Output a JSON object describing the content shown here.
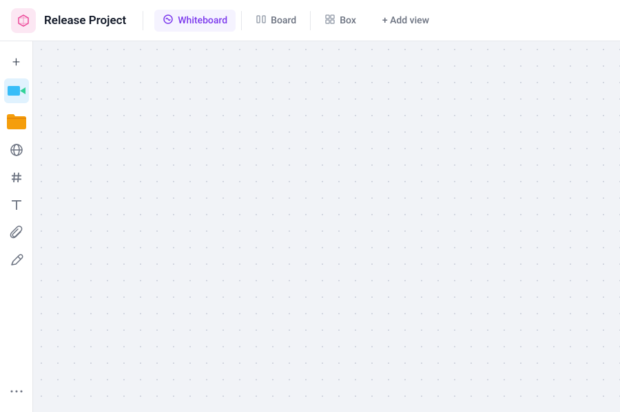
{
  "header": {
    "project_icon_label": "cube",
    "project_title": "Release Project",
    "tabs": [
      {
        "id": "whiteboard",
        "label": "Whiteboard",
        "icon": "whiteboard-icon",
        "active": true
      },
      {
        "id": "board",
        "label": "Board",
        "icon": "board-icon",
        "active": false
      },
      {
        "id": "box",
        "label": "Box",
        "icon": "box-icon",
        "active": false
      }
    ],
    "add_view_label": "+ Add view"
  },
  "sidebar": {
    "tools": [
      {
        "id": "add",
        "icon": "+",
        "label": "Add",
        "active": false
      },
      {
        "id": "globe",
        "icon": "🌐",
        "label": "Globe",
        "active": false
      },
      {
        "id": "hash",
        "icon": "#",
        "label": "Hash",
        "active": false
      },
      {
        "id": "text",
        "icon": "T",
        "label": "Text",
        "active": false
      },
      {
        "id": "attach",
        "icon": "📎",
        "label": "Attach",
        "active": false
      },
      {
        "id": "draw",
        "icon": "✏️",
        "label": "Draw",
        "active": false
      },
      {
        "id": "more",
        "icon": "...",
        "label": "More",
        "active": false
      }
    ]
  },
  "canvas": {
    "background_color": "#f1f3f7"
  },
  "colors": {
    "accent_purple": "#7c3aed",
    "accent_purple_light": "#f5f3ff",
    "project_icon_bg": "#fce7f3",
    "project_icon_color": "#ec4899"
  }
}
